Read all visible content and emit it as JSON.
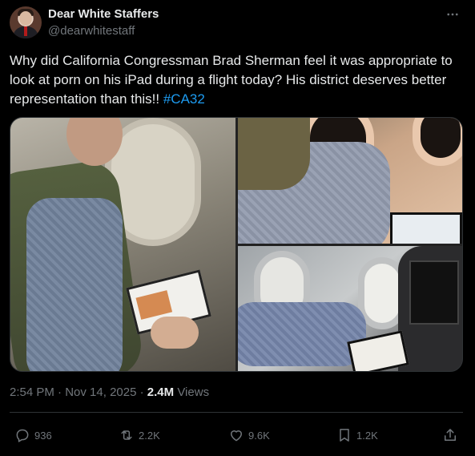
{
  "author": {
    "name": "Dear White Staffers",
    "handle": "@dearwhitestaff"
  },
  "tweet": {
    "text": "Why did California Congressman Brad Sherman feel it was appropriate to look at porn on his iPad during a flight today? His district deserves better representation than this!! ",
    "hashtag": "#CA32"
  },
  "meta": {
    "time": "2:54 PM",
    "sep1": " · ",
    "date": "Nov 14, 2025",
    "sep2": " · ",
    "views_count": "2.4M",
    "views_label": " Views"
  },
  "actions": {
    "replies": "936",
    "reposts": "2.2K",
    "likes": "9.6K",
    "bookmarks": "1.2K"
  },
  "icons": [
    "more-icon",
    "reply-icon",
    "repost-icon",
    "like-icon",
    "bookmark-icon",
    "share-icon"
  ],
  "colors": {
    "background": "#000000",
    "text": "#e7e9ea",
    "secondary": "#71767b",
    "link": "#1d9bf0",
    "border": "#2f3336"
  }
}
